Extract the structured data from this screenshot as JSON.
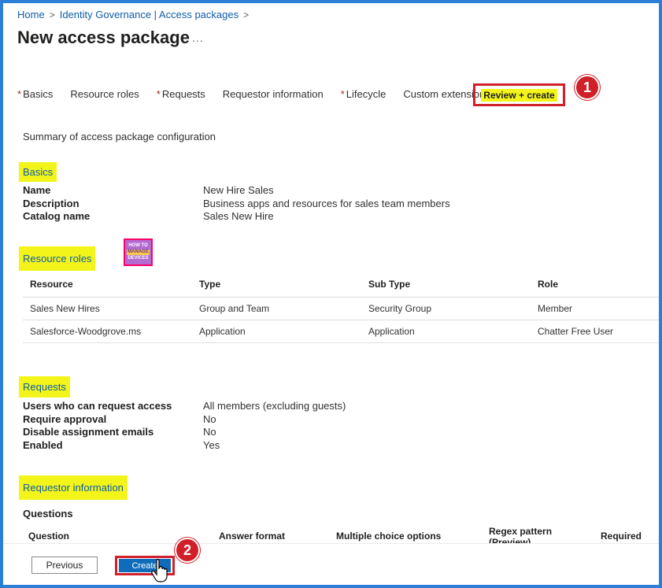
{
  "breadcrumb": {
    "home": "Home",
    "sep1": ">",
    "identity": "Identity Governance | Access packages",
    "sep2": ">"
  },
  "page": {
    "title": "New access package",
    "more": "..."
  },
  "tabs": {
    "basics": "Basics",
    "resource_roles": "Resource roles",
    "requests": "Requests",
    "requestor_information": "Requestor information",
    "lifecycle": "Lifecycle",
    "custom_extensions": "Custom extensions",
    "review_create": "Review + create",
    "required_mark": "*"
  },
  "callouts": {
    "one": "1",
    "two": "2"
  },
  "summary": "Summary of access package configuration",
  "basics": {
    "heading": "Basics",
    "rows": [
      {
        "k": "Name",
        "v": "New Hire Sales"
      },
      {
        "k": "Description",
        "v": "Business apps and resources for sales team members"
      },
      {
        "k": "Catalog name",
        "v": "Sales New Hire"
      }
    ]
  },
  "resource_roles": {
    "heading": "Resource roles",
    "logo_text": {
      "top": "HOW TO",
      "mid": "MANAGE",
      "bottom": "DEVICES"
    },
    "columns": [
      "Resource",
      "Type",
      "Sub Type",
      "Role"
    ],
    "rows": [
      [
        "Sales New Hires",
        "Group and Team",
        "Security Group",
        "Member"
      ],
      [
        "Salesforce-Woodgrove.ms",
        "Application",
        "Application",
        "Chatter Free User"
      ]
    ]
  },
  "requests": {
    "heading": "Requests",
    "rows": [
      {
        "k": "Users who can request access",
        "v": "All members (excluding guests)"
      },
      {
        "k": "Require approval",
        "v": "No"
      },
      {
        "k": "Disable assignment emails",
        "v": "No"
      },
      {
        "k": "Enabled",
        "v": "Yes"
      }
    ]
  },
  "requestor_information": {
    "heading": "Requestor information",
    "questions_title": "Questions",
    "columns": {
      "question": "Question",
      "answer_format": "Answer format",
      "multiple_choice": "Multiple choice options",
      "regex": "Regex pattern (Preview)",
      "required": "Required"
    }
  },
  "footer": {
    "previous": "Previous",
    "create": "Create"
  },
  "colors": {
    "accent": "#0f6cbd",
    "highlight": "#f3f51a",
    "callout_red": "#d0202a",
    "frame_blue": "#2b7fd6"
  }
}
